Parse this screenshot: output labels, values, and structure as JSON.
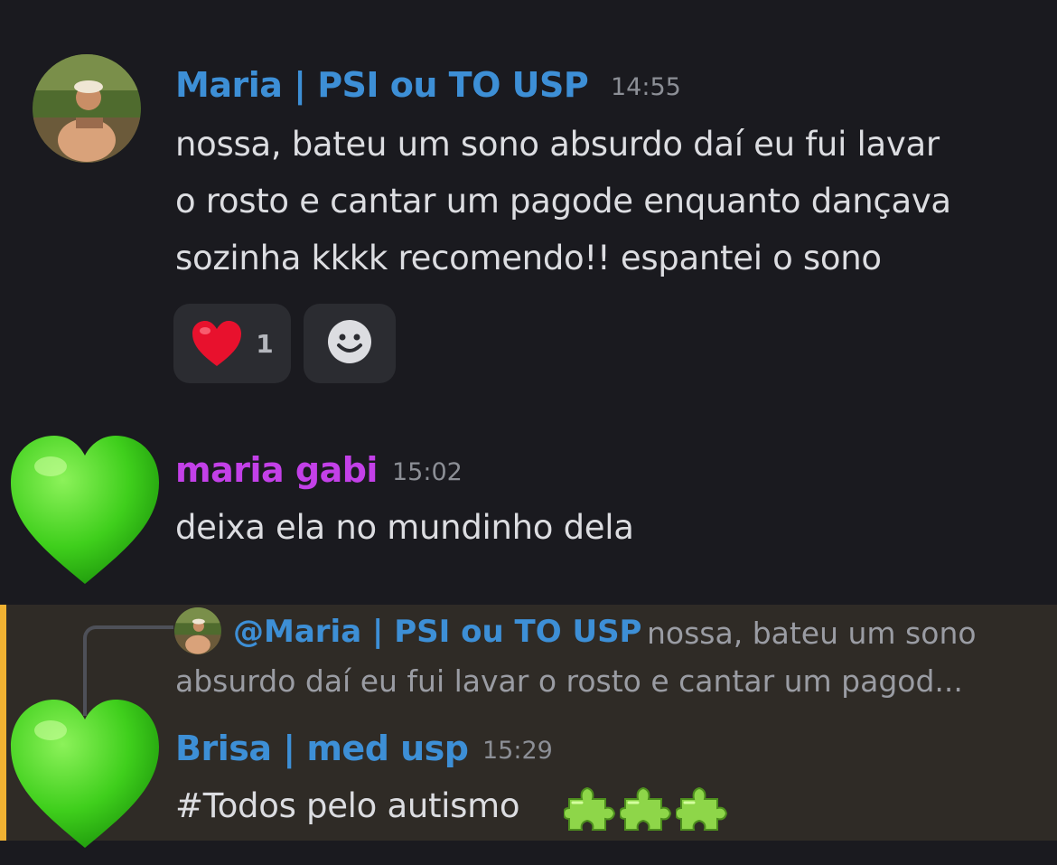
{
  "colors": {
    "background": "#1a1a1f",
    "highlight_background": "#2f2b26",
    "highlight_bar": "#f0b232",
    "blue_username": "#3d8fd6",
    "purple_username": "#c340e8",
    "timestamp": "#8c8f96"
  },
  "messages": [
    {
      "username": "Maria | PSI ou TO USP",
      "time": "14:55",
      "lines": [
        "nossa, bateu um sono absurdo daí eu fui lavar",
        "o rosto e cantar um pagode enquanto dançava",
        "sozinha kkkk recomendo!! espantei o sono"
      ],
      "avatar": "photo-avatar",
      "reactions": [
        {
          "emoji": "❤️",
          "icon": "red-heart-icon",
          "count": "1"
        },
        {
          "icon": "add-reaction-smiley-icon"
        }
      ]
    },
    {
      "username": "maria gabi",
      "time": "15:02",
      "text": "deixa ela no mundinho dela",
      "avatar": "green-heart-icon"
    },
    {
      "reply_to": {
        "mention": "@Maria | PSI ou TO USP",
        "preview_line1": "nossa, bateu um sono",
        "preview_line2": "absurdo daí eu fui lavar o rosto e cantar um pagod..."
      },
      "username": "Brisa | med usp",
      "time": "15:29",
      "text": "#Todos pelo autismo",
      "emoji_icons": [
        "puzzle-piece-icon",
        "puzzle-piece-icon",
        "puzzle-piece-icon"
      ],
      "avatar": "green-heart-icon"
    }
  ]
}
